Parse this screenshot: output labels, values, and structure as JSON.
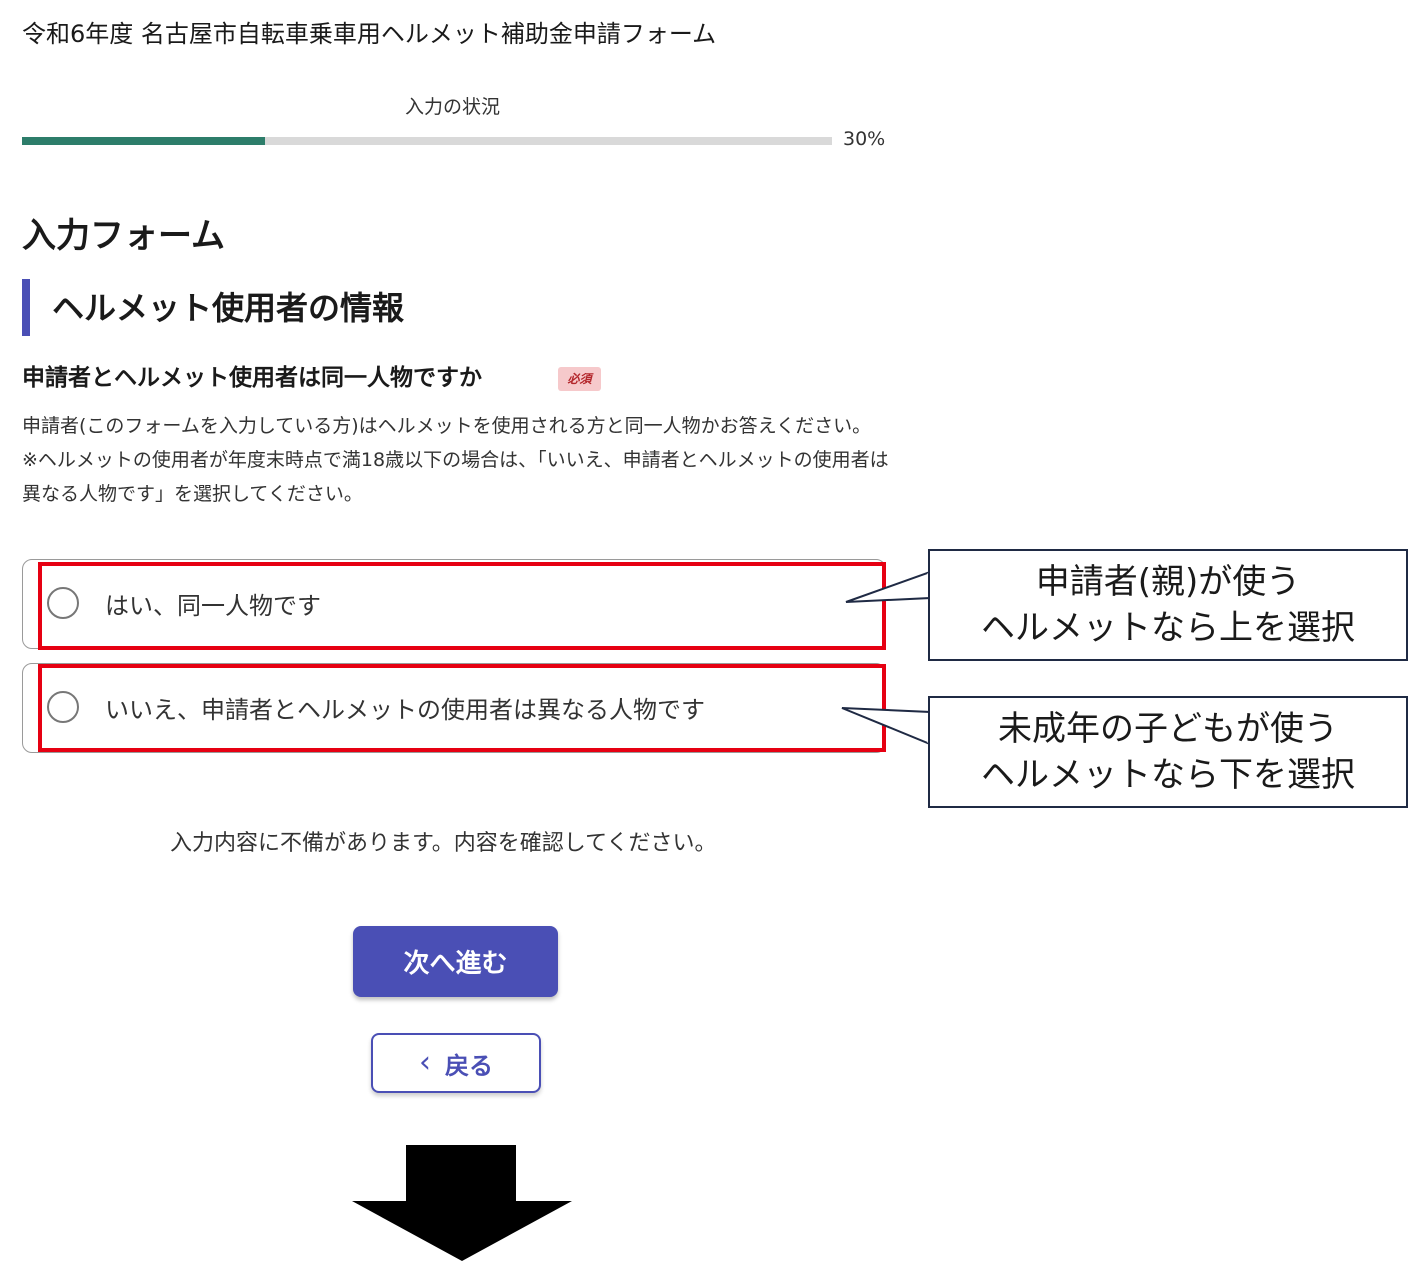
{
  "form": {
    "title": "令和6年度 名古屋市自転車乗車用ヘルメット補助金申請フォーム"
  },
  "progress": {
    "label": "入力の状況",
    "percent": 30,
    "percent_text": "30%",
    "fill_color": "#2d7d6a"
  },
  "main": {
    "heading": "入力フォーム",
    "section_heading": "ヘルメット使用者の情報",
    "section_accent_color": "#4a4fb5"
  },
  "question": {
    "label": "申請者とヘルメット使用者は同一人物ですか",
    "required_badge": "必須",
    "description_1": "申請者(このフォームを入力している方)はヘルメットを使用される方と同一人物かお答えください。",
    "description_2": "※ヘルメットの使用者が年度末時点で満18歳以下の場合は、「いいえ、申請者とヘルメットの使用者は異なる人物です」を選択してください。",
    "options": [
      {
        "label": "はい、同一人物です",
        "selected": false
      },
      {
        "label": "いいえ、申請者とヘルメットの使用者は異なる人物です",
        "selected": false
      }
    ]
  },
  "annotations": {
    "callout_1_line_1": "申請者(親)が使う",
    "callout_1_line_2": "ヘルメットなら上を選択",
    "callout_2_line_1": "未成年の子どもが使う",
    "callout_2_line_2": "ヘルメットなら下を選択",
    "highlight_color": "#e60012"
  },
  "error_message": "入力内容に不備があります。内容を確認してください。",
  "buttons": {
    "next_label": "次へ進む",
    "back_label": "戻る",
    "back_icon": "chevron-left-icon",
    "primary_color": "#4a4fb5"
  },
  "decorations": {
    "next_step_arrow_icon": "down-arrow-icon"
  }
}
